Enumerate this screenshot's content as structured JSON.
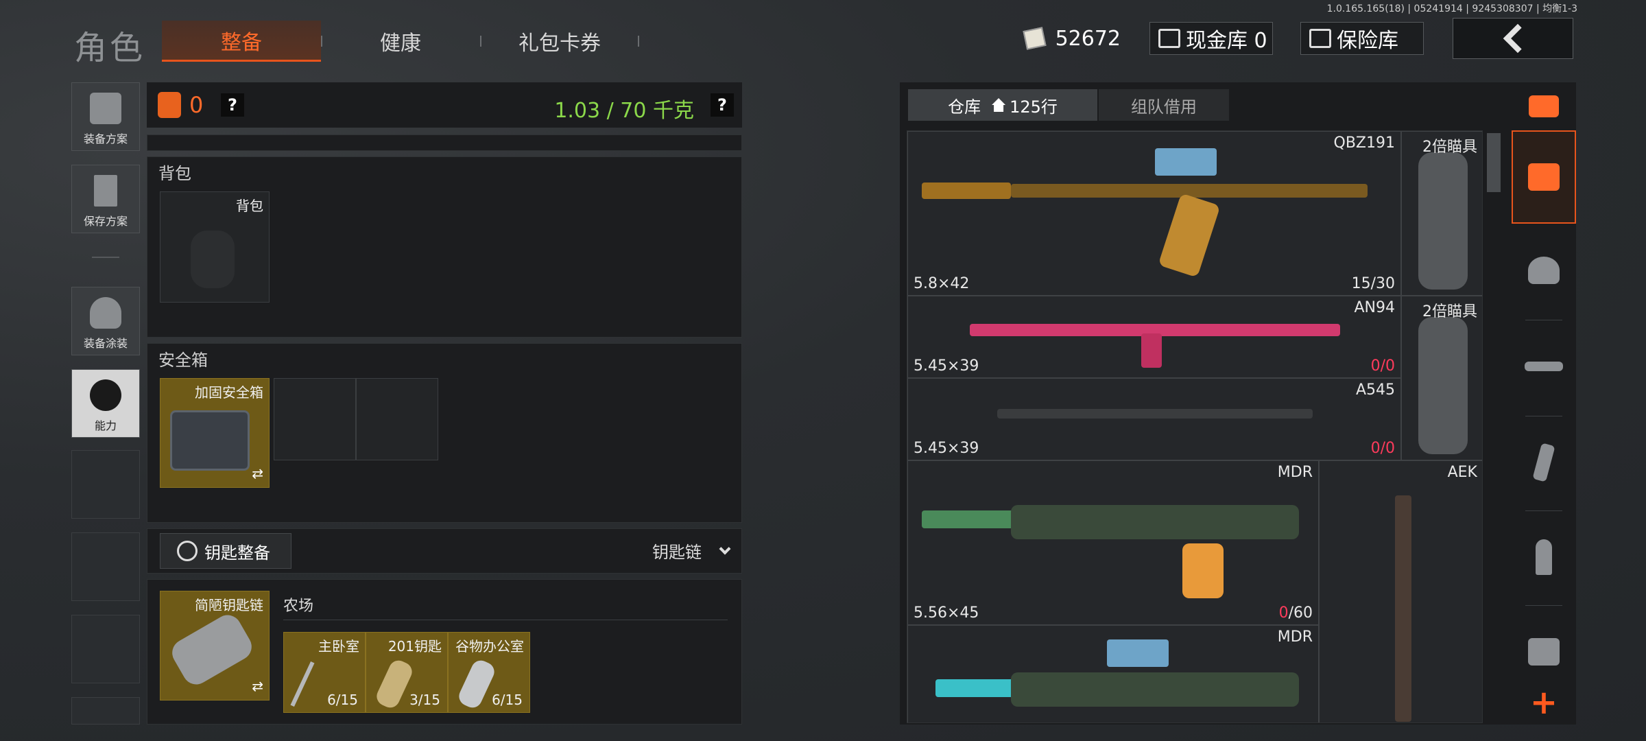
{
  "version": "1.0.165.165(18) | 05241914 | 9245308307 | 均衡1-3",
  "header": {
    "title": "角色",
    "tabs": [
      {
        "label": "整备",
        "active": true
      },
      {
        "label": "健康",
        "active": false
      },
      {
        "label": "礼包卡券",
        "active": false
      }
    ],
    "money": "52672",
    "cash_vault": "现金库 0",
    "safe_vault": "保险库"
  },
  "left_rail": {
    "items": [
      {
        "label": "装备方案",
        "icon": "vest-icon"
      },
      {
        "label": "保存方案",
        "icon": "download-icon"
      },
      {
        "label": "装备涂装",
        "icon": "helmet-icon"
      },
      {
        "label": "能力",
        "icon": "lightning-icon"
      }
    ]
  },
  "loadout": {
    "armor_count": "0",
    "qmark": "?",
    "weight": "1.03 / 70 千克",
    "backpack_section": "背包",
    "backpack_slot": "背包",
    "safe_section": "安全箱",
    "safe_item": "加固安全箱",
    "key_section_button": "钥匙整备",
    "keychain_dropdown": "钥匙链",
    "keychain_item": "简陋钥匙链",
    "key_location": "农场",
    "keys": [
      {
        "name": "主卧室",
        "count": "6/15"
      },
      {
        "name": "201钥匙",
        "count": "3/15"
      },
      {
        "name": "谷物办公室",
        "count": "6/15"
      }
    ]
  },
  "warehouse": {
    "tabs": [
      {
        "label": "仓库",
        "sub": "125行",
        "active": true
      },
      {
        "label": "组队借用",
        "active": false
      }
    ],
    "items": [
      {
        "name": "QBZ191",
        "ammo": "5.8×42",
        "cap": "15/30"
      },
      {
        "name": "2倍瞄具"
      },
      {
        "name": "AN94",
        "ammo": "5.45×39",
        "cap_a": "0",
        "cap_b": "/0"
      },
      {
        "name": "2倍瞄具"
      },
      {
        "name": "A545",
        "ammo": "5.45×39",
        "cap_a": "0",
        "cap_b": "/0"
      },
      {
        "name": "MDR",
        "ammo": "5.56×45",
        "cap_a": "0",
        "cap_b": "/60"
      },
      {
        "name": "AEK"
      },
      {
        "name": "MDR"
      }
    ]
  },
  "right_rail": {
    "icons": [
      "stack-refresh-icon",
      "stack-icon",
      "helmet-icon",
      "rifle-icon",
      "magazine-icon",
      "bullet-icon",
      "armor-icon"
    ],
    "plus": "+"
  },
  "colors": {
    "accent": "#e8541c",
    "weight_green": "#8bd84a",
    "ammo_red": "#ff3b5c",
    "slot_gold": "#6e5a17"
  }
}
